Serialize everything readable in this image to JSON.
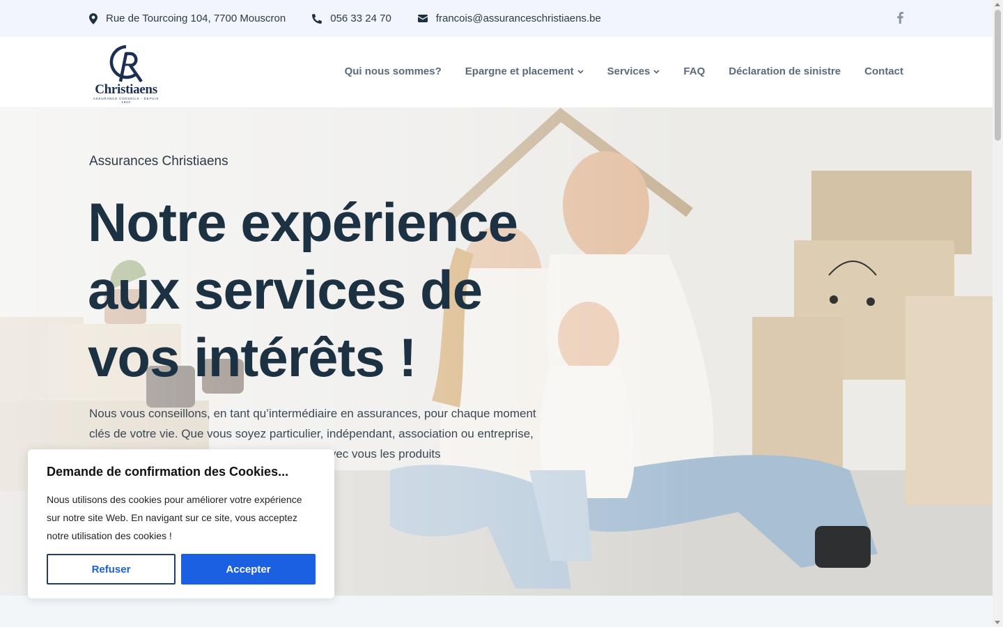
{
  "topbar": {
    "address": "Rue de Tourcoing 104, 7700 Mouscron",
    "phone": "056 33 24 70",
    "email": "francois@assuranceschristiaens.be",
    "social_icon": "facebook-icon"
  },
  "header": {
    "logo_word": "Christiaens",
    "logo_tagline": "ASSURANCE CONSEILS · DEPUIS 1923",
    "nav": [
      {
        "label": "Qui nous sommes?",
        "dropdown": false
      },
      {
        "label": "Epargne et placement",
        "dropdown": true
      },
      {
        "label": "Services",
        "dropdown": true
      },
      {
        "label": "FAQ",
        "dropdown": false
      },
      {
        "label": "Déclaration de sinistre",
        "dropdown": false
      },
      {
        "label": "Contact",
        "dropdown": false
      }
    ]
  },
  "hero": {
    "eyebrow": "Assurances Christiaens",
    "headline_1": "Notre expérience",
    "headline_2": "aux services de",
    "headline_3": "vos intérêts !",
    "lead": "Nous vous conseillons, en tant qu’intermédiaire en assurances, pour chaque moment clés de votre vie. Que vous soyez particulier, indépendant, association ou entreprise, nous sommes là pour vous guider et trouver avec vous les produits"
  },
  "cookie": {
    "title": "Demande de confirmation des Cookies...",
    "text": "Nous utilisons des cookies pour améliorer votre expérience sur notre site Web. En navigant sur ce site, vous acceptez notre utilisation des cookies !",
    "refuse_label": "Refuser",
    "accept_label": "Accepter"
  },
  "colors": {
    "topbar_bg": "#f2f5fb",
    "nav_text": "#5a6b7b",
    "headline": "#1c3142",
    "accept_button": "#1a60e0",
    "logo_navy": "#1b2f55"
  }
}
